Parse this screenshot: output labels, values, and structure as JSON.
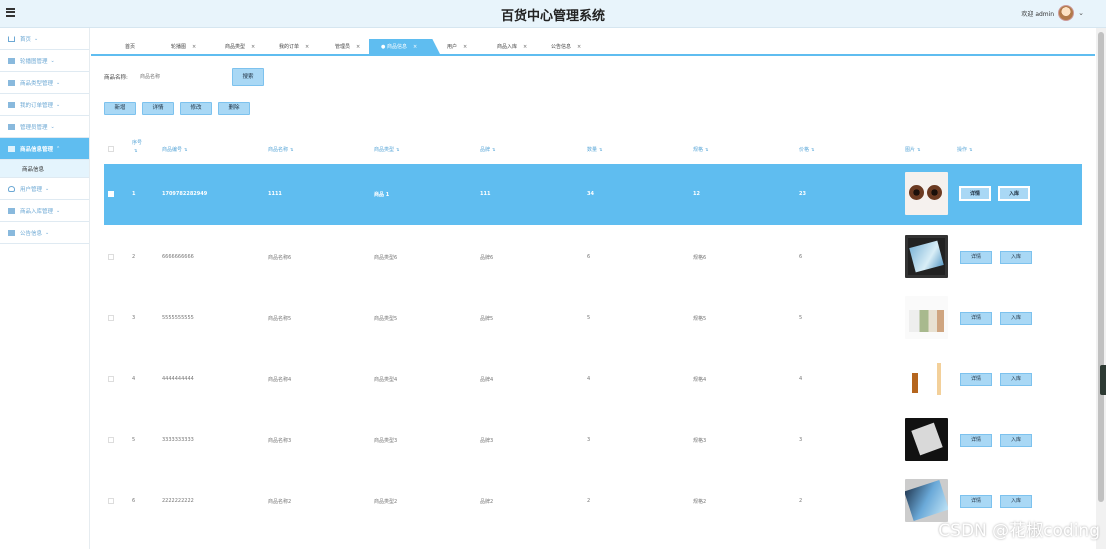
{
  "header": {
    "title": "百货中心管理系统",
    "welcome": "欢迎 admin"
  },
  "sidebar": {
    "items": [
      {
        "label": "首页"
      },
      {
        "label": "轮播图管理"
      },
      {
        "label": "商品类型管理"
      },
      {
        "label": "我的订单管理"
      },
      {
        "label": "管理员管理"
      },
      {
        "label": "商品信息管理"
      },
      {
        "label": "用户管理"
      },
      {
        "label": "商品入库管理"
      },
      {
        "label": "公告信息"
      }
    ],
    "sub_item": "商品信息"
  },
  "tabs": [
    {
      "label": "首页"
    },
    {
      "label": "轮播图"
    },
    {
      "label": "商品类型"
    },
    {
      "label": "我的订单"
    },
    {
      "label": "管理员"
    },
    {
      "label": "● 商品信息"
    },
    {
      "label": "用户"
    },
    {
      "label": "商品入库"
    },
    {
      "label": "公告信息"
    }
  ],
  "search": {
    "label": "商品名称:",
    "placeholder": "商品名称",
    "button": "搜索"
  },
  "actions": {
    "add": "新增",
    "detail": "详情",
    "edit": "修改",
    "delete": "删除"
  },
  "table": {
    "columns": [
      "序号",
      "商品编号",
      "商品名称",
      "商品类型",
      "品牌",
      "数量",
      "规格",
      "价格",
      "图片",
      "操作"
    ],
    "rows": [
      {
        "index": "1",
        "code": "1709782282949",
        "name": "1111",
        "type": "商品 1",
        "brand": "111",
        "qty": "34",
        "spec": "12",
        "price": "23"
      },
      {
        "index": "2",
        "code": "6666666666",
        "name": "商品名称6",
        "type": "商品类型6",
        "brand": "品牌6",
        "qty": "6",
        "spec": "规格6",
        "price": "6"
      },
      {
        "index": "3",
        "code": "5555555555",
        "name": "商品名称5",
        "type": "商品类型5",
        "brand": "品牌5",
        "qty": "5",
        "spec": "规格5",
        "price": "5"
      },
      {
        "index": "4",
        "code": "4444444444",
        "name": "商品名称4",
        "type": "商品类型4",
        "brand": "品牌4",
        "qty": "4",
        "spec": "规格4",
        "price": "4"
      },
      {
        "index": "5",
        "code": "3333333333",
        "name": "商品名称3",
        "type": "商品类型3",
        "brand": "品牌3",
        "qty": "3",
        "spec": "规格3",
        "price": "3"
      },
      {
        "index": "6",
        "code": "2222222222",
        "name": "商品名称2",
        "type": "商品类型2",
        "brand": "品牌2",
        "qty": "2",
        "spec": "规格2",
        "price": "2"
      }
    ],
    "row_buttons": {
      "detail": "详情",
      "stock_in": "入库"
    }
  },
  "watermark": "CSDN @花椒coding",
  "colors": {
    "accent": "#5fbdf0",
    "header_bg": "#e8f4fb",
    "sidebar_text": "#6ca8d4"
  }
}
